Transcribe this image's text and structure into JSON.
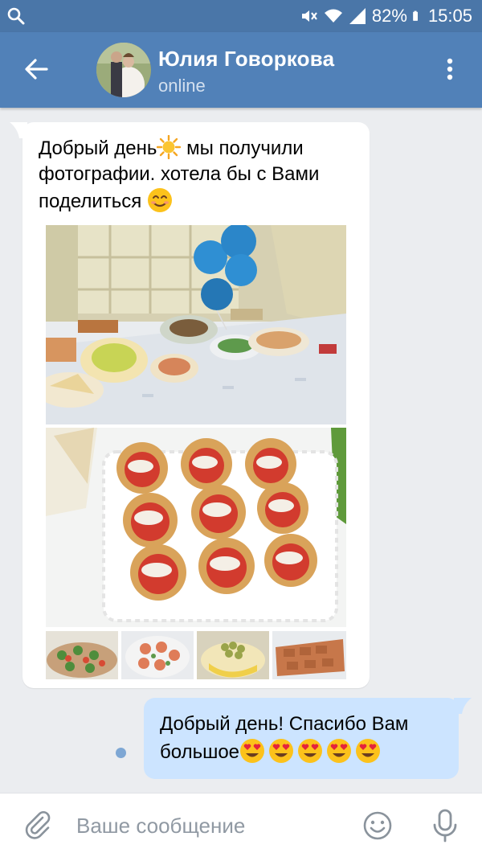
{
  "status_bar": {
    "battery": "82%",
    "time": "15:05"
  },
  "header": {
    "contact_name": "Юлия Говоркова",
    "contact_status": "online"
  },
  "messages": {
    "incoming": {
      "line1_pre": "Добрый день",
      "line1_post": " мы получили фотографии. хотела бы с Вами поделиться ",
      "emoji_1": "sun-emoji",
      "emoji_2": "smiling-face-emoji",
      "attachments": [
        "photo-banquet-table",
        "photo-tartlets",
        "photo-thumb-1",
        "photo-thumb-2",
        "photo-thumb-3",
        "photo-thumb-4"
      ]
    },
    "outgoing": {
      "text": "Добрый день! Спасибо Вам большое",
      "emoji": "heart-eyes-emoji",
      "emoji_count": 5,
      "read_state": "unread"
    }
  },
  "composer": {
    "placeholder": "Ваше сообщение"
  },
  "colors": {
    "header_bg": "#5181b8",
    "status_bar_bg": "#4a76a8",
    "chat_bg": "#ebedf0",
    "incoming_bubble": "#ffffff",
    "outgoing_bubble": "#cce4ff",
    "icon_gray": "#8a939c"
  }
}
